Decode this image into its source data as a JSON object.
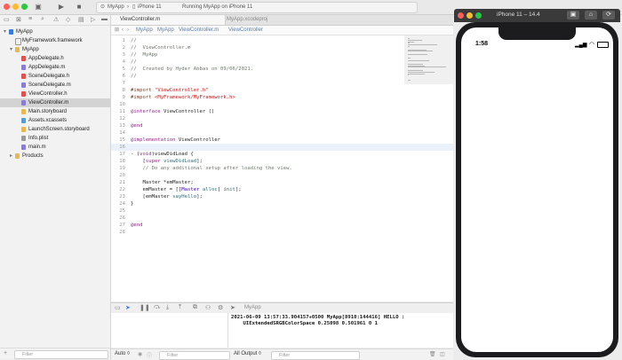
{
  "toolbar": {
    "scheme": "MyApp",
    "device": "iPhone 11",
    "status": "Running MyApp on iPhone 11"
  },
  "navigator": {
    "filter_placeholder": "Filter",
    "items": [
      {
        "label": "MyApp",
        "kind": "project",
        "indent": 0,
        "icon_color": "#3b7bd8"
      },
      {
        "label": "MyFramework.framework",
        "kind": "framework",
        "indent": 1,
        "icon_color": "#f0f0f0"
      },
      {
        "label": "MyApp",
        "kind": "folder",
        "indent": 1,
        "icon_color": "#e6b955"
      },
      {
        "label": "AppDelegate.h",
        "kind": "h",
        "indent": 2,
        "icon_color": "#d9534f"
      },
      {
        "label": "AppDelegate.m",
        "kind": "m",
        "indent": 2,
        "icon_color": "#8a7cd3"
      },
      {
        "label": "SceneDelegate.h",
        "kind": "h",
        "indent": 2,
        "icon_color": "#d9534f"
      },
      {
        "label": "SceneDelegate.m",
        "kind": "m",
        "indent": 2,
        "icon_color": "#8a7cd3"
      },
      {
        "label": "ViewController.h",
        "kind": "h",
        "indent": 2,
        "icon_color": "#d9534f"
      },
      {
        "label": "ViewController.m",
        "kind": "m",
        "indent": 2,
        "icon_color": "#8a7cd3",
        "selected": true
      },
      {
        "label": "Main.storyboard",
        "kind": "storyboard",
        "indent": 2,
        "icon_color": "#e6b955"
      },
      {
        "label": "Assets.xcassets",
        "kind": "assets",
        "indent": 2,
        "icon_color": "#5b9bd5"
      },
      {
        "label": "LaunchScreen.storyboard",
        "kind": "storyboard",
        "indent": 2,
        "icon_color": "#e6b955"
      },
      {
        "label": "Info.plist",
        "kind": "plist",
        "indent": 2,
        "icon_color": "#9a9a9a"
      },
      {
        "label": "main.m",
        "kind": "m",
        "indent": 2,
        "icon_color": "#8a7cd3"
      },
      {
        "label": "Products",
        "kind": "folder",
        "indent": 1,
        "icon_color": "#e6b955",
        "collapsed": true
      }
    ]
  },
  "tabs": [
    {
      "label": "ViewController.m",
      "active": true
    },
    {
      "label": "MyApp.xcodeproj",
      "active": false
    }
  ],
  "jump_bar": [
    "MyApp",
    "MyApp",
    "ViewController.m",
    "ViewController"
  ],
  "code_lines": [
    [
      {
        "t": "//",
        "c": "com"
      }
    ],
    [
      {
        "t": "//  ViewController.m",
        "c": "com"
      }
    ],
    [
      {
        "t": "//  MyApp",
        "c": "com"
      }
    ],
    [
      {
        "t": "//",
        "c": "com"
      }
    ],
    [
      {
        "t": "//  Created by Hyder Abbas on 09/06/2021.",
        "c": "com"
      }
    ],
    [
      {
        "t": "//",
        "c": "com"
      }
    ],
    [],
    [
      {
        "t": "#import ",
        "c": "pre"
      },
      {
        "t": "\"ViewController.h\"",
        "c": "str"
      }
    ],
    [
      {
        "t": "#import ",
        "c": "pre"
      },
      {
        "t": "<MyFramework/MyFramework.h>",
        "c": "str"
      }
    ],
    [],
    [
      {
        "t": "@interface ",
        "c": "kw"
      },
      {
        "t": "ViewController ()",
        "c": ""
      }
    ],
    [],
    [
      {
        "t": "@end",
        "c": "kw"
      }
    ],
    [],
    [
      {
        "t": "@implementation ",
        "c": "kw"
      },
      {
        "t": "ViewController",
        "c": ""
      }
    ],
    [],
    [
      {
        "t": "- (",
        "c": ""
      },
      {
        "t": "void",
        "c": "kw"
      },
      {
        "t": ")viewDidLoad {",
        "c": ""
      }
    ],
    [
      {
        "t": "    [",
        "c": ""
      },
      {
        "t": "super",
        "c": "kw"
      },
      {
        "t": " ",
        "c": ""
      },
      {
        "t": "viewDidLoad",
        "c": "meth"
      },
      {
        "t": "];",
        "c": ""
      }
    ],
    [
      {
        "t": "    // Do any additional setup after loading the view.",
        "c": "com"
      }
    ],
    [],
    [
      {
        "t": "    Master *emMaster;",
        "c": ""
      }
    ],
    [
      {
        "t": "    emMaster = [[",
        "c": ""
      },
      {
        "t": "Master",
        "c": "cls"
      },
      {
        "t": " ",
        "c": ""
      },
      {
        "t": "alloc",
        "c": "meth"
      },
      {
        "t": "] ",
        "c": ""
      },
      {
        "t": "init",
        "c": "meth"
      },
      {
        "t": "];",
        "c": ""
      }
    ],
    [
      {
        "t": "    [emMaster ",
        "c": ""
      },
      {
        "t": "sayHello",
        "c": "meth"
      },
      {
        "t": "];",
        "c": ""
      }
    ],
    [
      {
        "t": "}",
        "c": ""
      }
    ],
    [],
    [],
    [
      {
        "t": "@end",
        "c": "kw"
      }
    ],
    []
  ],
  "current_line": 16,
  "console": {
    "text": "2021-06-09 13:57:33.904157+0500 MyApp[8910:144416] HELLO :\n    UIExtendedSRGBColorSpace 0.25098 0.501961 0 1"
  },
  "debug_bar": {
    "target": "MyApp"
  },
  "bottom_bar": {
    "auto_label": "Auto ◊",
    "filter_left": "Filter",
    "output_label": "All Output ◊",
    "filter_right": "Filter"
  },
  "simulator": {
    "title": "iPhone 11 – 14.4",
    "time": "1:58"
  }
}
